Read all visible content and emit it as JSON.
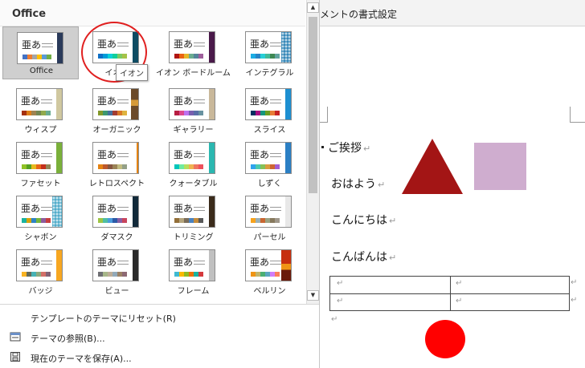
{
  "panel": {
    "title": "Office",
    "tooltip": "イオン",
    "themes": [
      {
        "label": "Office",
        "accent": "#2a3a5a",
        "pattern": "none",
        "swatches": [
          "#4472c4",
          "#ed7d31",
          "#a5a5a5",
          "#ffc000",
          "#5b9bd5",
          "#70ad47"
        ]
      },
      {
        "label": "イオン",
        "accent": "#0e4c63",
        "pattern": "none",
        "swatches": [
          "#0f6fc6",
          "#009dd9",
          "#0bd0d9",
          "#10cf9b",
          "#7cca62",
          "#a5c249"
        ]
      },
      {
        "label": "イオン ボードルーム",
        "accent": "#4a1a4a",
        "pattern": "ion-board",
        "swatches": [
          "#b01513",
          "#ea6312",
          "#e6b729",
          "#6aac90",
          "#54849a",
          "#9e5e9b"
        ]
      },
      {
        "label": "インテグラル",
        "accent": "#2e83b5",
        "pattern": "diamond",
        "swatches": [
          "#1cade4",
          "#2683c6",
          "#27ced7",
          "#42ba97",
          "#3e8853",
          "#62a39f"
        ]
      },
      {
        "label": "ウィスプ",
        "accent": "#d0c8a0",
        "pattern": "lines",
        "swatches": [
          "#a53010",
          "#de7e18",
          "#9f8351",
          "#728653",
          "#92aa4c",
          "#6aac91"
        ]
      },
      {
        "label": "オーガニック",
        "accent": "#6b4a2a",
        "pattern": "wood",
        "swatches": [
          "#83992a",
          "#3c9770",
          "#44709d",
          "#a23c33",
          "#d97828",
          "#deb340"
        ]
      },
      {
        "label": "ギャラリー",
        "accent": "#c9b89a",
        "pattern": "gradient",
        "swatches": [
          "#b71e42",
          "#de478e",
          "#bc72f0",
          "#795faf",
          "#586ea6",
          "#6892a0"
        ]
      },
      {
        "label": "スライス",
        "accent": "#1d8fd1",
        "pattern": "slice",
        "swatches": [
          "#052f61",
          "#a50e82",
          "#14967c",
          "#6a9e1f",
          "#e87d37",
          "#c62324"
        ]
      },
      {
        "label": "ファセット",
        "accent": "#7ab03a",
        "pattern": "facet",
        "swatches": [
          "#90c226",
          "#54a021",
          "#e6b91e",
          "#e76618",
          "#c42f1a",
          "#918655"
        ]
      },
      {
        "label": "レトロスペクト",
        "accent": "#ffffff",
        "pattern": "retro",
        "swatches": [
          "#e48312",
          "#bd582c",
          "#865640",
          "#9b8357",
          "#c2bc80",
          "#94a088"
        ]
      },
      {
        "label": "クォータブル",
        "accent": "#2bb7b0",
        "pattern": "quote",
        "swatches": [
          "#00c6bb",
          "#6feba0",
          "#b6df5e",
          "#efb251",
          "#ef755f",
          "#ed515c"
        ]
      },
      {
        "label": "しずく",
        "accent": "#2b7fc4",
        "pattern": "drop",
        "swatches": [
          "#2fa3ee",
          "#4bcaad",
          "#86c157",
          "#d99c3f",
          "#ce6633",
          "#a35dd1"
        ]
      },
      {
        "label": "シャボン",
        "accent": "#4aa9c8",
        "pattern": "bubble",
        "swatches": [
          "#1ab39f",
          "#d5a20b",
          "#2d83c6",
          "#76b53c",
          "#8d5c9d",
          "#c73e3e"
        ]
      },
      {
        "label": "ダマスク",
        "accent": "#122a3a",
        "pattern": "none",
        "swatches": [
          "#9ec544",
          "#50bea3",
          "#4a9bdc",
          "#2c5aa6",
          "#885ea4",
          "#c8455c"
        ]
      },
      {
        "label": "トリミング",
        "accent": "#3b2b1b",
        "pattern": "trim",
        "swatches": [
          "#936f39",
          "#b5a57d",
          "#7a6c59",
          "#4a82c0",
          "#c58b3b",
          "#585858"
        ]
      },
      {
        "label": "パーセル",
        "accent": "#e8e8e8",
        "pattern": "parcel",
        "swatches": [
          "#f6a21d",
          "#9bafb5",
          "#c96731",
          "#9ca383",
          "#87795d",
          "#a0988c"
        ]
      },
      {
        "label": "バッジ",
        "accent": "#f7a721",
        "pattern": "badge",
        "swatches": [
          "#f8b323",
          "#656a59",
          "#46b2b5",
          "#8caa7e",
          "#d36f68",
          "#826276"
        ]
      },
      {
        "label": "ビュー",
        "accent": "#2a2a2a",
        "pattern": "none",
        "swatches": [
          "#6f6f74",
          "#a7b789",
          "#beae98",
          "#92a9b9",
          "#9c8265",
          "#8d6974"
        ]
      },
      {
        "label": "フレーム",
        "accent": "#c0c0c0",
        "pattern": "frame",
        "swatches": [
          "#40bad2",
          "#fab900",
          "#90bb23",
          "#ee7008",
          "#1ab39f",
          "#d5393d"
        ]
      },
      {
        "label": "ベルリン",
        "accent": "#c62f0f",
        "pattern": "berlin",
        "swatches": [
          "#f09415",
          "#c1b56b",
          "#4baf73",
          "#5aa6c0",
          "#d17df9",
          "#fa7e5c"
        ]
      }
    ],
    "menu": {
      "reset_label": "テンプレートのテーマにリセット(R)",
      "browse_label": "テーマの参照(B)...",
      "save_label": "現在のテーマを保存(A)..."
    }
  },
  "document": {
    "ribbon_text": "メントの書式設定",
    "heading": "ご挨拶",
    "line1": "おはよう",
    "line2": "こんにちは",
    "line3": "こんばんは",
    "para_mark": "↵",
    "shape_colors": {
      "triangle": "#a31515",
      "rectangle": "#cfadcf",
      "circle": "#ff0000"
    }
  }
}
